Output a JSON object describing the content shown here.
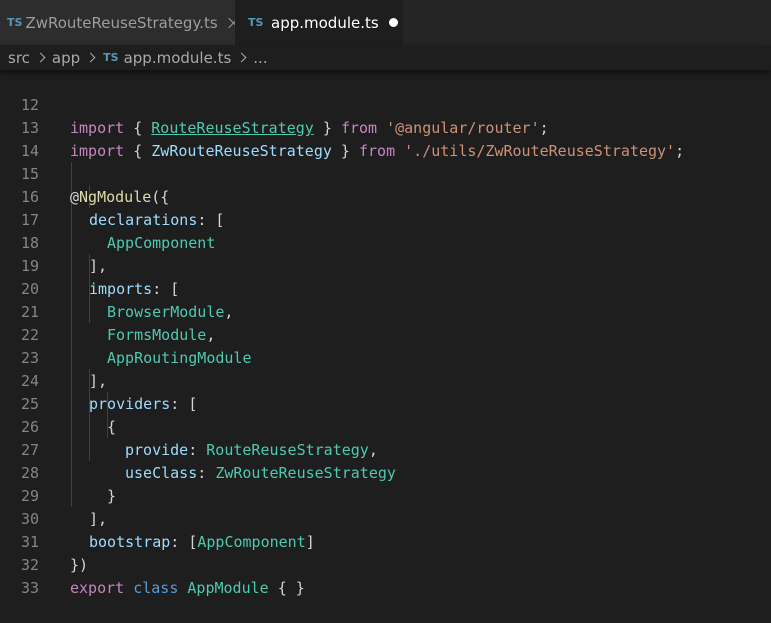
{
  "tabs": [
    {
      "badge": "TS",
      "label": "ZwRouteReuseStrategy.ts"
    },
    {
      "badge": "TS",
      "label": "app.module.ts"
    }
  ],
  "breadcrumb": {
    "items": [
      "src",
      "app"
    ],
    "file_badge": "TS",
    "file": "app.module.ts",
    "more": "..."
  },
  "code": {
    "l12": {
      "n": "12",
      "a": "import",
      "b": " { ",
      "c": "RouteReuseStrategy",
      "d": " } ",
      "e": "from",
      "f": " ",
      "g": "'@angular/router'",
      "h": ";"
    },
    "l13": {
      "n": "13",
      "a": "import",
      "b": " { ",
      "c": "ZwRouteReuseStrategy",
      "d": " } ",
      "e": "from",
      "f": " ",
      "g": "'./utils/ZwRouteReuseStrategy'",
      "h": ";"
    },
    "l14": {
      "n": "14"
    },
    "l15": {
      "n": "15",
      "a": "@",
      "b": "NgModule",
      "c": "({"
    },
    "l16": {
      "n": "16",
      "a": "declarations",
      "b": ": ["
    },
    "l17": {
      "n": "17",
      "a": "AppComponent"
    },
    "l18": {
      "n": "18",
      "a": "],"
    },
    "l19": {
      "n": "19",
      "a": "imports",
      "b": ": ["
    },
    "l20": {
      "n": "20",
      "a": "BrowserModule",
      "b": ","
    },
    "l21": {
      "n": "21",
      "a": "FormsModule",
      "b": ","
    },
    "l22": {
      "n": "22",
      "a": "AppRoutingModule"
    },
    "l23": {
      "n": "23",
      "a": "],"
    },
    "l24": {
      "n": "24",
      "a": "providers",
      "b": ": ["
    },
    "l25": {
      "n": "25",
      "a": "{"
    },
    "l26": {
      "n": "26",
      "a": "provide",
      "b": ": ",
      "c": "RouteReuseStrategy",
      "d": ","
    },
    "l27": {
      "n": "27",
      "a": "useClass",
      "b": ": ",
      "c": "ZwRouteReuseStrategy"
    },
    "l28": {
      "n": "28",
      "a": "}"
    },
    "l29": {
      "n": "29",
      "a": "],"
    },
    "l30": {
      "n": "30",
      "a": "bootstrap",
      "b": ": [",
      "c": "AppComponent",
      "d": "]"
    },
    "l31": {
      "n": "31",
      "a": "})"
    },
    "l32": {
      "n": "32",
      "a": "export",
      "b": " ",
      "c": "class",
      "d": " ",
      "e": "AppModule",
      "f": " { }"
    },
    "l33": {
      "n": "33"
    }
  }
}
